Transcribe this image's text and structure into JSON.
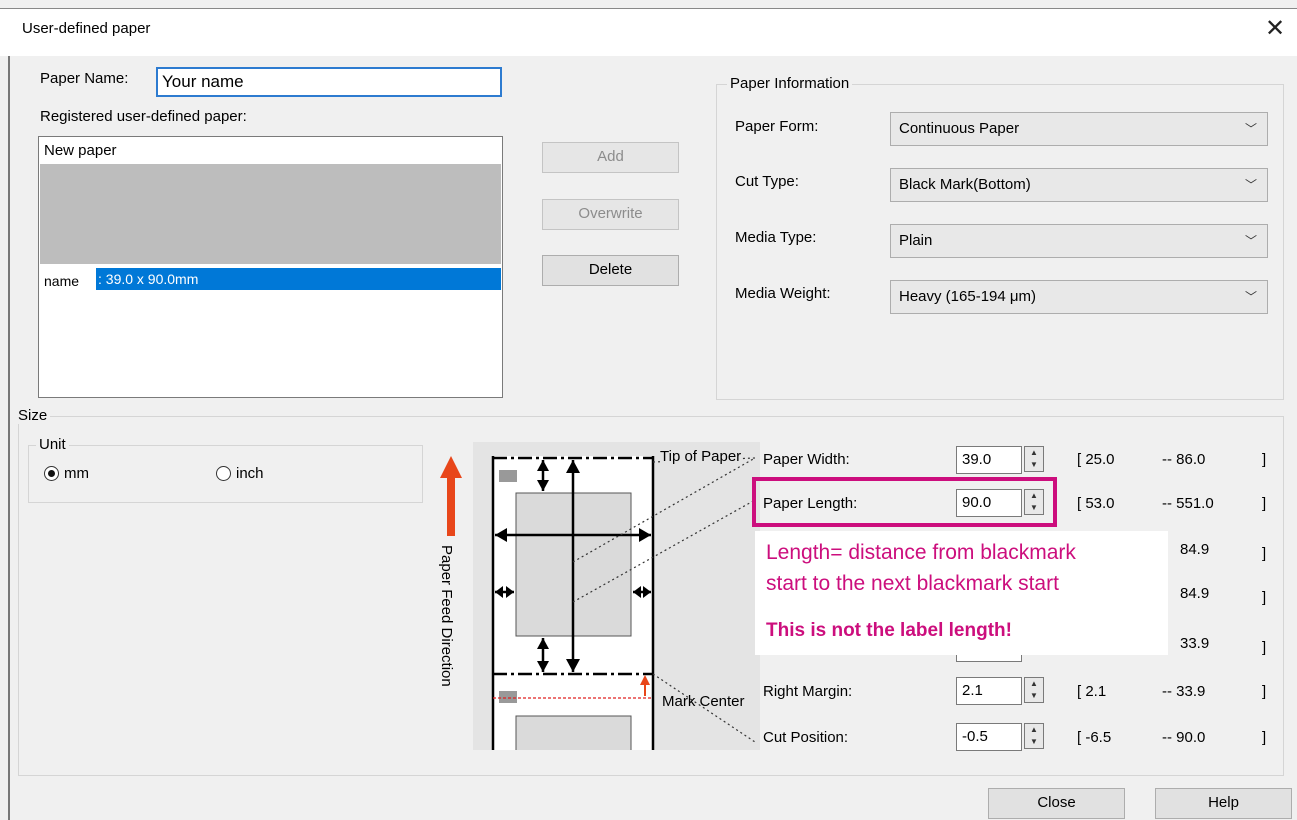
{
  "window": {
    "title": "User-defined paper",
    "close_icon": "close-icon"
  },
  "paper_name": {
    "label": "Paper Name:",
    "value": "Your name"
  },
  "registered": {
    "label": "Registered user-defined paper:",
    "items": [
      "New paper",
      "name",
      ": 39.0 x 90.0mm"
    ]
  },
  "buttons": {
    "add": "Add",
    "overwrite": "Overwrite",
    "delete": "Delete",
    "close": "Close",
    "help": "Help"
  },
  "paper_info": {
    "group_label": "Paper Information",
    "paper_form_label": "Paper Form:",
    "paper_form_value": "Continuous Paper",
    "cut_type_label": "Cut Type:",
    "cut_type_value": "Black Mark(Bottom)",
    "media_type_label": "Media Type:",
    "media_type_value": "Plain",
    "media_weight_label": "Media Weight:",
    "media_weight_value": "Heavy (165-194 μm)"
  },
  "size": {
    "group_label": "Size",
    "unit_label": "Unit",
    "unit_mm": "mm",
    "unit_inch": "inch",
    "unit_selected": "mm"
  },
  "diagram": {
    "tip_label": "Tip of Paper",
    "mark_center_label": "Mark Center",
    "feed_direction": "Paper Feed Direction"
  },
  "fields": {
    "paper_width": {
      "label": "Paper Width:",
      "value": "39.0",
      "min": "[ 25.0",
      "max": "-- 86.0",
      "close": "]"
    },
    "paper_length": {
      "label": "Paper Length:",
      "value": "90.0",
      "min": "[ 53.0",
      "max": "-- 551.0",
      "close": "]"
    },
    "hidden1": {
      "max": "84.9",
      "close": "]"
    },
    "hidden2": {
      "max": "84.9",
      "close": "]"
    },
    "hidden3": {
      "max": "33.9",
      "close": "]"
    },
    "right_margin": {
      "label": "Right Margin:",
      "value": "2.1",
      "min": "[ 2.1",
      "max": "-- 33.9",
      "close": "]"
    },
    "cut_position": {
      "label": "Cut Position:",
      "value": "-0.5",
      "min": "[ -6.5",
      "max": "-- 90.0",
      "close": "]"
    }
  },
  "annotation": {
    "line1": "Length= distance from blackmark",
    "line2": "start to the next blackmark start",
    "line3": "This is not the label length!",
    "color": "#cc0e7d"
  }
}
